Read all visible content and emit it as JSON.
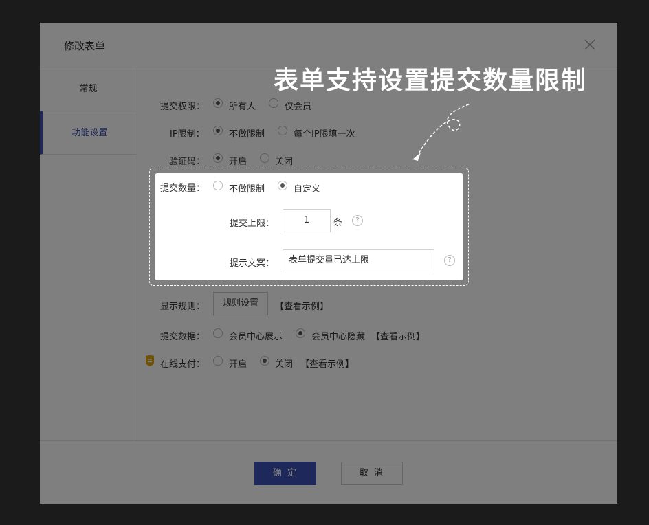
{
  "dialog": {
    "title": "修改表单",
    "sidebar": {
      "items": [
        {
          "label": "常规"
        },
        {
          "label": "功能设置"
        }
      ]
    },
    "form": {
      "permission": {
        "label": "提交权限：",
        "options": [
          "所有人",
          "仅会员"
        ],
        "selected": "所有人"
      },
      "ip_limit": {
        "label": "IP限制：",
        "options": [
          "不做限制",
          "每个IP限填一次"
        ],
        "selected": "不做限制"
      },
      "captcha": {
        "label": "验证码：",
        "options": [
          "开启",
          "关闭"
        ],
        "selected": "开启"
      },
      "submit_count": {
        "label": "提交数量：",
        "options": [
          "不做限制",
          "自定义"
        ],
        "selected": "自定义",
        "limit_label": "提交上限：",
        "limit_value": "1",
        "limit_unit": "条",
        "message_label": "提示文案：",
        "message_value": "表单提交量已达上限"
      },
      "display_rule": {
        "label": "显示规则：",
        "button": "规则设置",
        "example": "【查看示例】"
      },
      "submit_data": {
        "label": "提交数据：",
        "options": [
          "会员中心展示",
          "会员中心隐藏"
        ],
        "selected": "会员中心隐藏",
        "example": "【查看示例】"
      },
      "online_payment": {
        "label": "在线支付：",
        "options": [
          "开启",
          "关闭"
        ],
        "selected": "关闭",
        "example": "【查看示例】"
      }
    },
    "footer": {
      "confirm": "确 定",
      "cancel": "取 消"
    }
  },
  "annotation": {
    "callout": "表单支持设置提交数量限制"
  },
  "help_icon_glyph": "?",
  "colors": {
    "accent": "#3f51b5",
    "overlay": "rgba(0,0,0,0.5)",
    "background": "#373737"
  }
}
